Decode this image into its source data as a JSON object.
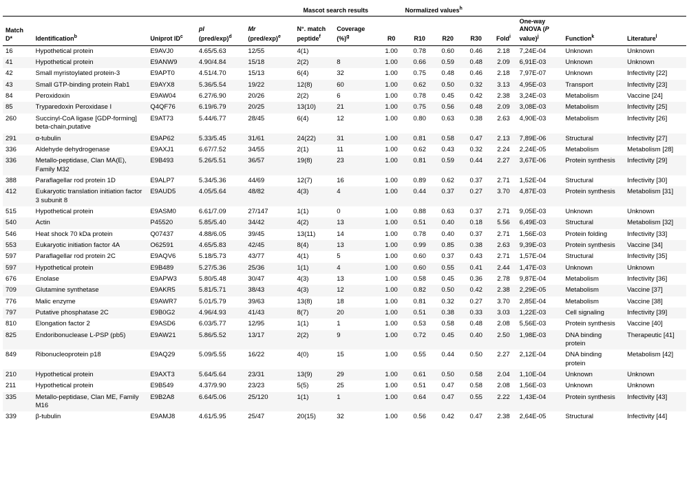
{
  "table": {
    "group_mascot": "Mascot search results",
    "group_normalized": "Normalized values",
    "columns": [
      {
        "key": "match_id",
        "label": "Match\nD*",
        "class": "col-matchid"
      },
      {
        "key": "identification",
        "label": "Identification",
        "class": "col-ident",
        "sup": "b"
      },
      {
        "key": "uniprot",
        "label": "Uniprot ID",
        "class": "col-uniprot",
        "sup": "c"
      },
      {
        "key": "pi",
        "label": "pI\n(pred/exp)",
        "class": "col-pi",
        "sup": "d"
      },
      {
        "key": "mr",
        "label": "Mr\n(pred/exp)",
        "class": "col-mr",
        "sup": "e"
      },
      {
        "key": "match_peptide",
        "label": "N°. match\npeptide",
        "class": "col-match",
        "sup": "f"
      },
      {
        "key": "coverage",
        "label": "Coverage\n(%)",
        "class": "col-coverage",
        "sup": "g"
      },
      {
        "key": "r0",
        "label": "R0",
        "class": "col-r0"
      },
      {
        "key": "r10",
        "label": "R10",
        "class": "col-r10"
      },
      {
        "key": "r20",
        "label": "R20",
        "class": "col-r20"
      },
      {
        "key": "r30",
        "label": "R30",
        "class": "col-r30"
      },
      {
        "key": "fold",
        "label": "Fold",
        "class": "col-fold",
        "sup": "i"
      },
      {
        "key": "anova",
        "label": "One-way\nANOVA (P\nvalue)",
        "class": "col-anova",
        "sup": "j"
      },
      {
        "key": "function",
        "label": "Function",
        "class": "col-function",
        "sup": "k"
      },
      {
        "key": "literature",
        "label": "Literature",
        "class": "col-lit",
        "sup": "l"
      }
    ],
    "rows": [
      {
        "match_id": "16",
        "identification": "Hypothetical protein",
        "uniprot": "E9AVJ0",
        "pi": "4.65/5.63",
        "mr": "12/55",
        "match_peptide": "4(1)",
        "coverage": "",
        "r0": "1.00",
        "r10": "0.78",
        "r20": "0.60",
        "r30": "0.46",
        "fold": "2.18",
        "anova": "7,24E-04",
        "function": "Unknown",
        "literature": "Unknown"
      },
      {
        "match_id": "41",
        "identification": "Hypothetical protein",
        "uniprot": "E9ANW9",
        "pi": "4.90/4.84",
        "mr": "15/18",
        "match_peptide": "2(2)",
        "coverage": "8",
        "r0": "1.00",
        "r10": "0.66",
        "r20": "0.59",
        "r30": "0.48",
        "fold": "2.09",
        "anova": "6,91E-03",
        "function": "Unknown",
        "literature": "Unknown"
      },
      {
        "match_id": "42",
        "identification": "Small myristoylated protein-3",
        "uniprot": "E9APT0",
        "pi": "4.51/4.70",
        "mr": "15/13",
        "match_peptide": "6(4)",
        "coverage": "32",
        "r0": "1.00",
        "r10": "0.75",
        "r20": "0.48",
        "r30": "0.46",
        "fold": "2.18",
        "anova": "7,97E-07",
        "function": "Unknown",
        "literature": "Infectivity [22]"
      },
      {
        "match_id": "43",
        "identification": "Small GTP-binding protein Rab1",
        "uniprot": "E9AYX8",
        "pi": "5.36/5.54",
        "mr": "19/22",
        "match_peptide": "12(8)",
        "coverage": "60",
        "r0": "1.00",
        "r10": "0.62",
        "r20": "0.50",
        "r30": "0.32",
        "fold": "3.13",
        "anova": "4,95E-03",
        "function": "Transport",
        "literature": "Infectivity [23]"
      },
      {
        "match_id": "84",
        "identification": "Peroxidoxin",
        "uniprot": "E9AW04",
        "pi": "6.27/6.90",
        "mr": "20/26",
        "match_peptide": "2(2)",
        "coverage": "6",
        "r0": "1.00",
        "r10": "0.78",
        "r20": "0.45",
        "r30": "0.42",
        "fold": "2.38",
        "anova": "3,24E-03",
        "function": "Metabolism",
        "literature": "Vaccine [24]"
      },
      {
        "match_id": "85",
        "identification": "Tryparedoxin Peroxidase I",
        "uniprot": "Q4QF76",
        "pi": "6.19/6.79",
        "mr": "20/25",
        "match_peptide": "13(10)",
        "coverage": "21",
        "r0": "1.00",
        "r10": "0.75",
        "r20": "0.56",
        "r30": "0.48",
        "fold": "2.09",
        "anova": "3,08E-03",
        "function": "Metabolism",
        "literature": "Infectivity [25]"
      },
      {
        "match_id": "260",
        "identification": "Succinyl-CoA ligase [GDP-forming] beta-chain,putative",
        "uniprot": "E9AT73",
        "pi": "5.44/6.77",
        "mr": "28/45",
        "match_peptide": "6(4)",
        "coverage": "12",
        "r0": "1.00",
        "r10": "0.80",
        "r20": "0.63",
        "r30": "0.38",
        "fold": "2.63",
        "anova": "4,90E-03",
        "function": "Metabolism",
        "literature": "Infectivity [26]"
      },
      {
        "match_id": "291",
        "identification": "α-tubulin",
        "uniprot": "E9AP62",
        "pi": "5.33/5.45",
        "mr": "31/61",
        "match_peptide": "24(22)",
        "coverage": "31",
        "r0": "1.00",
        "r10": "0.81",
        "r20": "0.58",
        "r30": "0.47",
        "fold": "2.13",
        "anova": "7,89E-06",
        "function": "Structural",
        "literature": "Infectivity [27]"
      },
      {
        "match_id": "336",
        "identification": "Aldehyde dehydrogenase",
        "uniprot": "E9AXJ1",
        "pi": "6.67/7.52",
        "mr": "34/55",
        "match_peptide": "2(1)",
        "coverage": "11",
        "r0": "1.00",
        "r10": "0.62",
        "r20": "0.43",
        "r30": "0.32",
        "fold": "2.24",
        "anova": "2,24E-05",
        "function": "Metabolism",
        "literature": "Metabolism [28]"
      },
      {
        "match_id": "336",
        "identification": "Metallo-peptidase, Clan MA(E), Family M32",
        "uniprot": "E9B493",
        "pi": "5.26/5.51",
        "mr": "36/57",
        "match_peptide": "19(8)",
        "coverage": "23",
        "r0": "1.00",
        "r10": "0.81",
        "r20": "0.59",
        "r30": "0.44",
        "fold": "2.27",
        "anova": "3,67E-06",
        "function": "Protein synthesis",
        "literature": "Infectivity [29]"
      },
      {
        "match_id": "388",
        "identification": "Paraflagellar rod protein 1D",
        "uniprot": "E9ALP7",
        "pi": "5.34/5.36",
        "mr": "44/69",
        "match_peptide": "12(7)",
        "coverage": "16",
        "r0": "1.00",
        "r10": "0.89",
        "r20": "0.62",
        "r30": "0.37",
        "fold": "2.71",
        "anova": "1,52E-04",
        "function": "Structural",
        "literature": "Infectivity [30]"
      },
      {
        "match_id": "412",
        "identification": "Eukaryotic translation initiation factor 3 subunit 8",
        "uniprot": "E9AUD5",
        "pi": "4.05/5.64",
        "mr": "48/82",
        "match_peptide": "4(3)",
        "coverage": "4",
        "r0": "1.00",
        "r10": "0.44",
        "r20": "0.37",
        "r30": "0.27",
        "fold": "3.70",
        "anova": "4,87E-03",
        "function": "Protein synthesis",
        "literature": "Metabolism [31]"
      },
      {
        "match_id": "515",
        "identification": "Hypothetical protein",
        "uniprot": "E9ASM0",
        "pi": "6.61/7.09",
        "mr": "27/147",
        "match_peptide": "1(1)",
        "coverage": "0",
        "r0": "1.00",
        "r10": "0.88",
        "r20": "0.63",
        "r30": "0.37",
        "fold": "2.71",
        "anova": "9,05E-03",
        "function": "Unknown",
        "literature": "Unknown"
      },
      {
        "match_id": "540",
        "identification": "Actin",
        "uniprot": "P45520",
        "pi": "5.85/5.40",
        "mr": "34/42",
        "match_peptide": "4(2)",
        "coverage": "13",
        "r0": "1.00",
        "r10": "0.51",
        "r20": "0.40",
        "r30": "0.18",
        "fold": "5.56",
        "anova": "6,49E-03",
        "function": "Structural",
        "literature": "Metabolism [32]"
      },
      {
        "match_id": "546",
        "identification": "Heat shock 70 kDa protein",
        "uniprot": "Q07437",
        "pi": "4.88/6.05",
        "mr": "39/45",
        "match_peptide": "13(11)",
        "coverage": "14",
        "r0": "1.00",
        "r10": "0.78",
        "r20": "0.40",
        "r30": "0.37",
        "fold": "2.71",
        "anova": "1,56E-03",
        "function": "Protein folding",
        "literature": "Infectivity [33]"
      },
      {
        "match_id": "553",
        "identification": "Eukaryotic initiation factor 4A",
        "uniprot": "O62591",
        "pi": "4.65/5.83",
        "mr": "42/45",
        "match_peptide": "8(4)",
        "coverage": "13",
        "r0": "1.00",
        "r10": "0.99",
        "r20": "0.85",
        "r30": "0.38",
        "fold": "2.63",
        "anova": "9,39E-03",
        "function": "Protein synthesis",
        "literature": "Vaccine [34]"
      },
      {
        "match_id": "597",
        "identification": "Paraflagellar rod protein 2C",
        "uniprot": "E9AQV6",
        "pi": "5.18/5.73",
        "mr": "43/77",
        "match_peptide": "4(1)",
        "coverage": "5",
        "r0": "1.00",
        "r10": "0.60",
        "r20": "0.37",
        "r30": "0.43",
        "fold": "2.71",
        "anova": "1,57E-04",
        "function": "Structural",
        "literature": "Infectivity [35]"
      },
      {
        "match_id": "597",
        "identification": "Hypothetical protein",
        "uniprot": "E9B489",
        "pi": "5.27/5.36",
        "mr": "25/36",
        "match_peptide": "1(1)",
        "coverage": "4",
        "r0": "1.00",
        "r10": "0.60",
        "r20": "0.55",
        "r30": "0.41",
        "fold": "2.44",
        "anova": "1,47E-03",
        "function": "Unknown",
        "literature": "Unknown"
      },
      {
        "match_id": "676",
        "identification": "Enolase",
        "uniprot": "E9APW3",
        "pi": "5.80/5.48",
        "mr": "30/47",
        "match_peptide": "4(3)",
        "coverage": "13",
        "r0": "1.00",
        "r10": "0.58",
        "r20": "0.45",
        "r30": "0.36",
        "fold": "2.78",
        "anova": "9,87E-04",
        "function": "Metabolism",
        "literature": "Infectivity [36]"
      },
      {
        "match_id": "709",
        "identification": "Glutamine synthetase",
        "uniprot": "E9AKR5",
        "pi": "5.81/5.71",
        "mr": "38/43",
        "match_peptide": "4(3)",
        "coverage": "12",
        "r0": "1.00",
        "r10": "0.82",
        "r20": "0.50",
        "r30": "0.42",
        "fold": "2.38",
        "anova": "2,29E-05",
        "function": "Metabolism",
        "literature": "Vaccine [37]"
      },
      {
        "match_id": "776",
        "identification": "Malic enzyme",
        "uniprot": "E9AWR7",
        "pi": "5.01/5.79",
        "mr": "39/63",
        "match_peptide": "13(8)",
        "coverage": "18",
        "r0": "1.00",
        "r10": "0.81",
        "r20": "0.32",
        "r30": "0.27",
        "fold": "3.70",
        "anova": "2,85E-04",
        "function": "Metabolism",
        "literature": "Vaccine [38]"
      },
      {
        "match_id": "797",
        "identification": "Putative phosphatase 2C",
        "uniprot": "E9B0G2",
        "pi": "4.96/4.93",
        "mr": "41/43",
        "match_peptide": "8(7)",
        "coverage": "20",
        "r0": "1.00",
        "r10": "0.51",
        "r20": "0.38",
        "r30": "0.33",
        "fold": "3.03",
        "anova": "1,22E-03",
        "function": "Cell signaling",
        "literature": "Infectivity [39]"
      },
      {
        "match_id": "810",
        "identification": "Elongation factor 2",
        "uniprot": "E9ASD6",
        "pi": "6.03/5.77",
        "mr": "12/95",
        "match_peptide": "1(1)",
        "coverage": "1",
        "r0": "1.00",
        "r10": "0.53",
        "r20": "0.58",
        "r30": "0.48",
        "fold": "2.08",
        "anova": "5,56E-03",
        "function": "Protein synthesis",
        "literature": "Vaccine [40]"
      },
      {
        "match_id": "825",
        "identification": "Endoribonuclease L-PSP (pb5)",
        "uniprot": "E9AW21",
        "pi": "5.86/5.52",
        "mr": "13/17",
        "match_peptide": "2(2)",
        "coverage": "9",
        "r0": "1.00",
        "r10": "0.72",
        "r20": "0.45",
        "r30": "0.40",
        "fold": "2.50",
        "anova": "1,98E-03",
        "function": "DNA binding protein",
        "literature": "Therapeutic [41]"
      },
      {
        "match_id": "849",
        "identification": "Ribonucleoprotein p18",
        "uniprot": "E9AQ29",
        "pi": "5.09/5.55",
        "mr": "16/22",
        "match_peptide": "4(0)",
        "coverage": "15",
        "r0": "1.00",
        "r10": "0.55",
        "r20": "0.44",
        "r30": "0.50",
        "fold": "2.27",
        "anova": "2,12E-04",
        "function": "DNA binding protein",
        "literature": "Metabolism [42]"
      },
      {
        "match_id": "210",
        "identification": "Hypothetical protein",
        "uniprot": "E9AXT3",
        "pi": "5.64/5.64",
        "mr": "23/31",
        "match_peptide": "13(9)",
        "coverage": "29",
        "r0": "1.00",
        "r10": "0.61",
        "r20": "0.50",
        "r30": "0.58",
        "fold": "2.04",
        "anova": "1,10E-04",
        "function": "Unknown",
        "literature": "Unknown"
      },
      {
        "match_id": "211",
        "identification": "Hypothetical protein",
        "uniprot": "E9B549",
        "pi": "4.37/9.90",
        "mr": "23/23",
        "match_peptide": "5(5)",
        "coverage": "25",
        "r0": "1.00",
        "r10": "0.51",
        "r20": "0.47",
        "r30": "0.58",
        "fold": "2.08",
        "anova": "1,56E-03",
        "function": "Unknown",
        "literature": "Unknown"
      },
      {
        "match_id": "335",
        "identification": "Metallo-peptidase, Clan ME, Family M16",
        "uniprot": "E9B2A8",
        "pi": "6.64/5.06",
        "mr": "25/120",
        "match_peptide": "1(1)",
        "coverage": "1",
        "r0": "1.00",
        "r10": "0.64",
        "r20": "0.47",
        "r30": "0.55",
        "fold": "2.22",
        "anova": "1,43E-04",
        "function": "Protein synthesis",
        "literature": "Infectivity [43]"
      },
      {
        "match_id": "339",
        "identification": "β-tubulin",
        "uniprot": "E9AMJ8",
        "pi": "4.61/5.95",
        "mr": "25/47",
        "match_peptide": "20(15)",
        "coverage": "32",
        "r0": "1.00",
        "r10": "0.56",
        "r20": "0.42",
        "r30": "0.47",
        "fold": "2.38",
        "anova": "2,64E-05",
        "function": "Structural",
        "literature": "Infectivity [44]"
      }
    ]
  }
}
